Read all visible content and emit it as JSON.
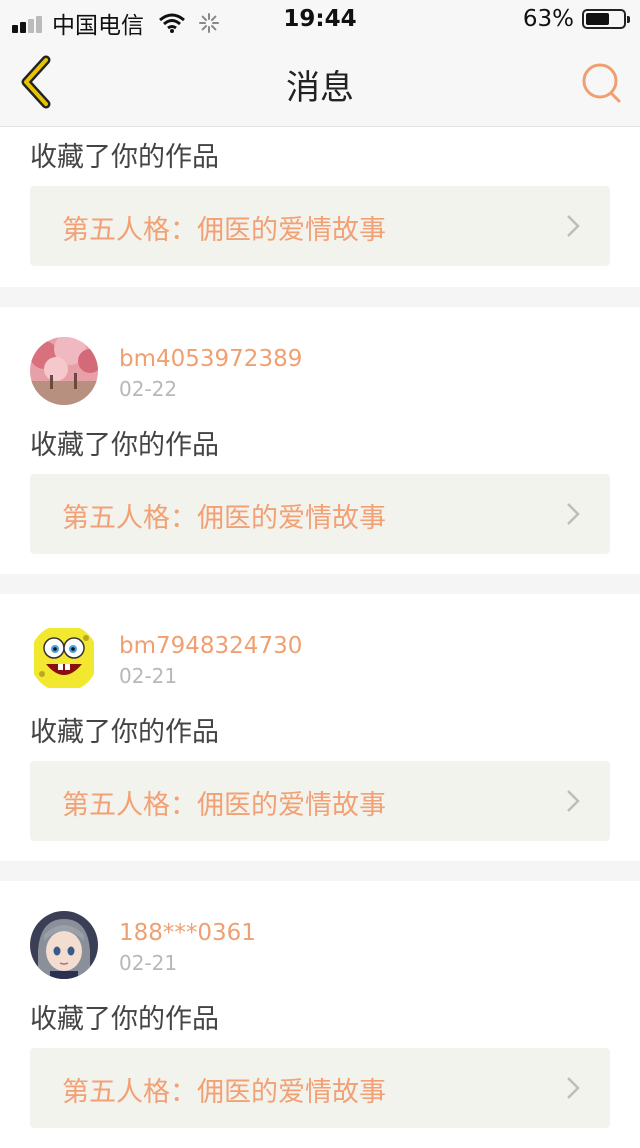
{
  "status_bar": {
    "carrier": "中国电信",
    "time": "19:44",
    "battery": "63%",
    "battery_level": 0.63
  },
  "nav": {
    "title": "消息",
    "back_icon": "chevron-left-icon",
    "search_icon": "search-icon"
  },
  "colors": {
    "accent": "#f0a070",
    "back_icon": "#d9b400"
  },
  "messages": [
    {
      "action": "收藏了你的作品",
      "work_title": "第五人格：佣医的爱情故事"
    },
    {
      "username": "bm4053972389",
      "date": "02-22",
      "action": "收藏了你的作品",
      "work_title": "第五人格：佣医的爱情故事"
    },
    {
      "username": "bm7948324730",
      "date": "02-21",
      "action": "收藏了你的作品",
      "work_title": "第五人格：佣医的爱情故事"
    },
    {
      "username": "188***0361",
      "date": "02-21",
      "action": "收藏了你的作品",
      "work_title": "第五人格：佣医的爱情故事"
    }
  ]
}
